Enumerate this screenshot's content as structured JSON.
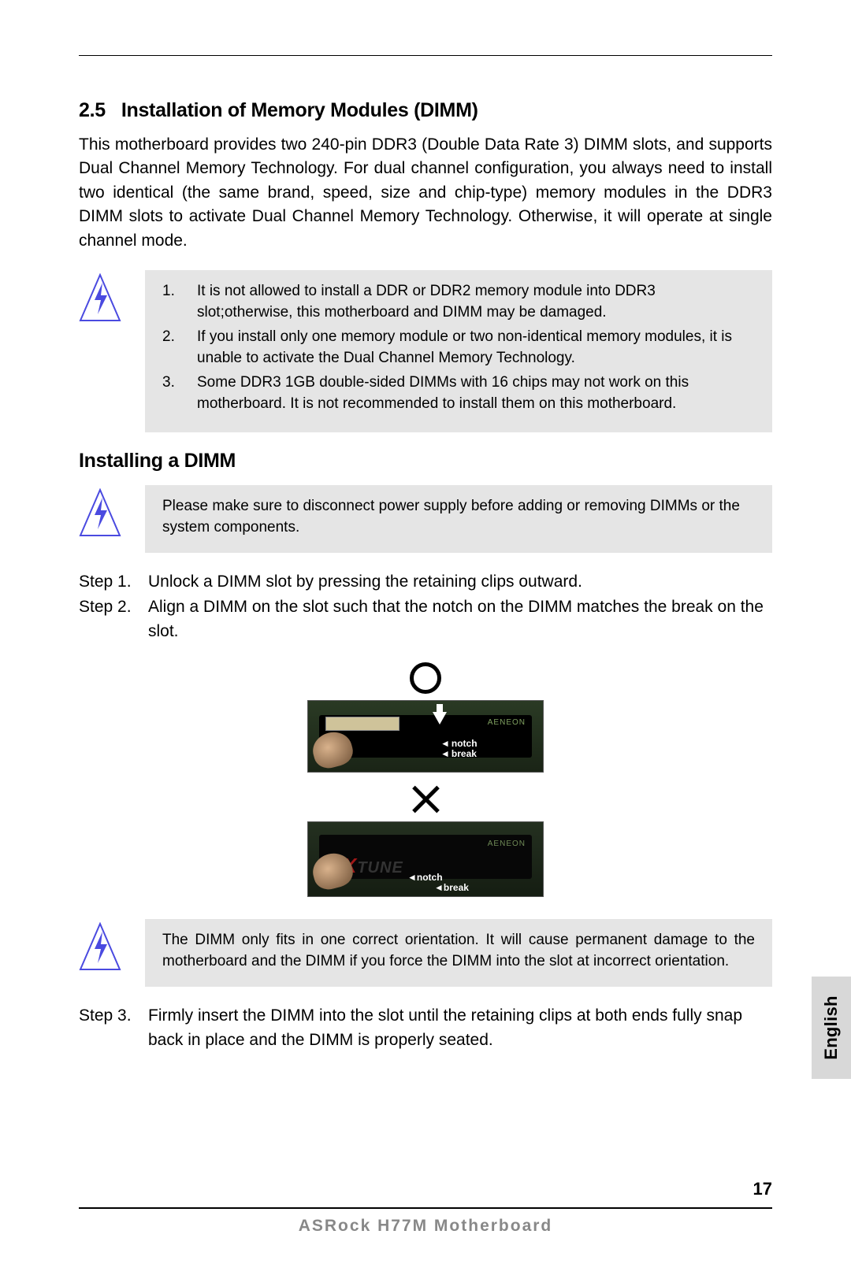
{
  "section": {
    "number": "2.5",
    "title": "Installation of Memory Modules (DIMM)",
    "intro": "This motherboard provides two 240-pin DDR3 (Double Data Rate 3) DIMM slots, and supports Dual Channel Memory Technology. For dual channel configuration, you always need to install two identical (the same brand, speed, size and chip-type) memory modules in the DDR3 DIMM slots to activate Dual Channel Memory Technology. Otherwise, it will operate at single channel mode."
  },
  "warnings1": [
    {
      "n": "1.",
      "t": "It is not allowed to install a DDR or DDR2 memory module into DDR3 slot;otherwise, this motherboard and DIMM may be damaged."
    },
    {
      "n": "2.",
      "t": "If you install only one memory module or two non-identical memory modules, it is unable to activate the Dual Channel Memory Technology."
    },
    {
      "n": "3.",
      "t": "Some DDR3 1GB double-sided DIMMs with 16 chips may not work on this motherboard. It is not recommended to install them on this motherboard."
    }
  ],
  "sub": {
    "title": "Installing a DIMM",
    "warn": "Please make sure to disconnect power supply before adding or removing DIMMs or the system components."
  },
  "steps": [
    {
      "label": "Step 1.",
      "text": "Unlock a DIMM slot by pressing the retaining clips outward."
    },
    {
      "label": "Step 2.",
      "text": "Align a DIMM on the slot such that the notch on the DIMM matches the break on the slot."
    }
  ],
  "diagram": {
    "notch": "notch",
    "break": "break",
    "brand": "AENEON",
    "xtune": "TUNE"
  },
  "warn3": "The DIMM only fits in one correct orientation. It will cause permanent damage to the motherboard and the DIMM if you force the DIMM into the slot at incorrect orientation.",
  "step3": {
    "label": "Step 3.",
    "text": "Firmly insert the DIMM into the slot until the retaining clips at both ends fully snap back in place and the DIMM is properly seated."
  },
  "footer": {
    "title": "ASRock  H77M  Motherboard",
    "page": "17"
  },
  "sidetab": "English"
}
